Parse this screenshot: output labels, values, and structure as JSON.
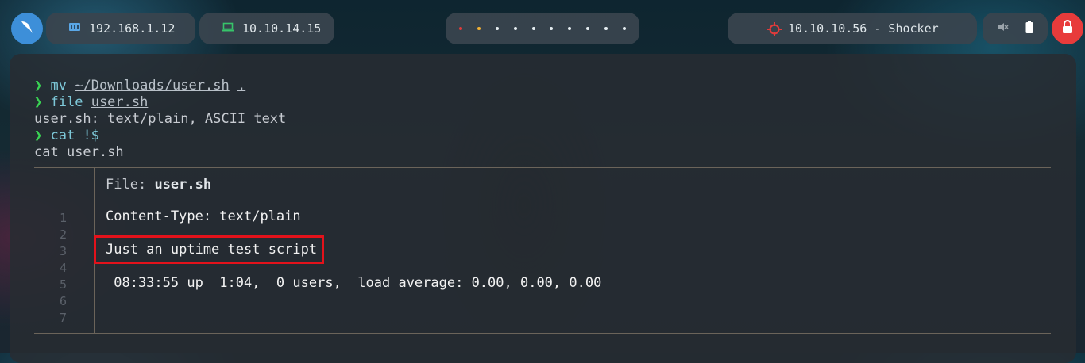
{
  "topbar": {
    "launcher_icon": "app-launcher-icon",
    "host_ip": "192.168.1.12",
    "vpn_ip": "10.10.14.15",
    "workspace_dot_colors": [
      "#e23b3b",
      "#f2b134",
      "#e6eef2",
      "#e6eef2",
      "#e6eef2",
      "#e6eef2",
      "#e6eef2",
      "#e6eef2",
      "#e6eef2",
      "#e6eef2"
    ],
    "target_text": "10.10.10.56 - Shocker",
    "target_icon": "crosshair-icon",
    "mute_icon": "speaker-muted-icon",
    "battery_icon": "battery-icon",
    "lock_icon": "lock-icon",
    "accent_red": "#e83b3b",
    "accent_blue": "#3d8fd9"
  },
  "terminal": {
    "prompt_symbol": "❯",
    "lines": [
      {
        "cmd": "mv",
        "args": [
          "~/Downloads/user.sh",
          "."
        ]
      },
      {
        "cmd": "file",
        "args": [
          "user.sh"
        ]
      },
      {
        "output": "user.sh: text/plain, ASCII text"
      },
      {
        "cmd": "cat !$"
      },
      {
        "output": "cat user.sh"
      }
    ],
    "bat": {
      "file_label": "File:",
      "file_name": "user.sh",
      "line_numbers": [
        "1",
        "2",
        "3",
        "4",
        "5",
        "6",
        "7"
      ],
      "content": [
        "Content-Type: text/plain",
        "",
        "Just an uptime test script",
        "",
        " 08:33:55 up  1:04,  0 users,  load average: 0.00, 0.00, 0.00",
        "",
        ""
      ],
      "highlighted_line": 3,
      "highlight_color": "#e3121b"
    }
  }
}
